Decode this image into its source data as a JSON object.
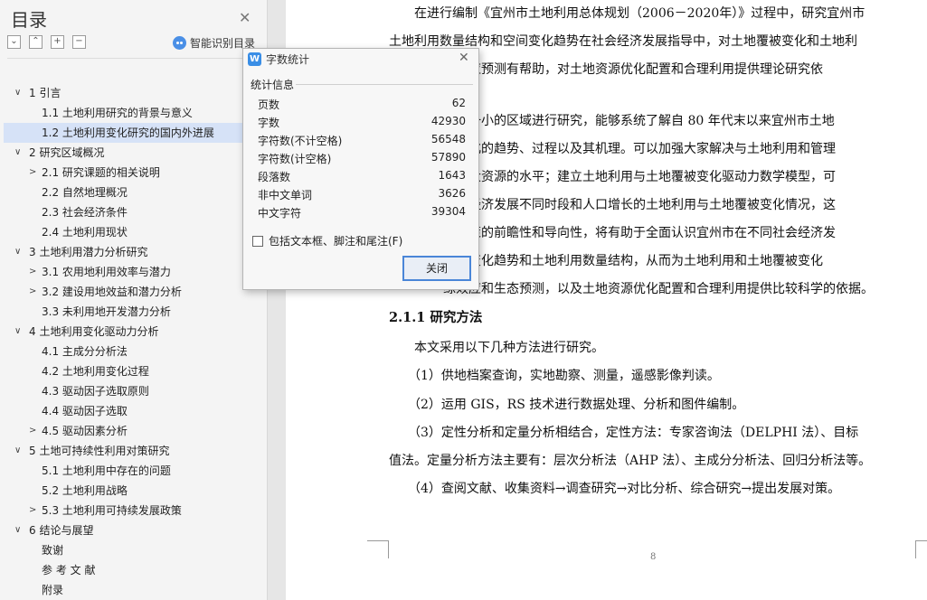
{
  "sidebar": {
    "title": "目录",
    "smart_toc_label": "智能识别目录",
    "tools": [
      "⌄",
      "⌃",
      "+",
      "−"
    ],
    "items": [
      {
        "label": "1  引言",
        "level": 1,
        "caret": "∨",
        "selected": false
      },
      {
        "label": "1.1  土地利用研究的背景与意义",
        "level": 2,
        "caret": "",
        "selected": false
      },
      {
        "label": "1.2  土地利用变化研究的国内外进展",
        "level": 2,
        "caret": "",
        "selected": true
      },
      {
        "label": "2  研究区域概况",
        "level": 1,
        "caret": "∨",
        "selected": false
      },
      {
        "label": "2.1  研究课题的相关说明",
        "level": 2,
        "caret": ">",
        "selected": false
      },
      {
        "label": "2.2  自然地理概况",
        "level": 2,
        "caret": "",
        "selected": false
      },
      {
        "label": "2.3  社会经济条件",
        "level": 2,
        "caret": "",
        "selected": false
      },
      {
        "label": "2.4  土地利用现状",
        "level": 2,
        "caret": "",
        "selected": false
      },
      {
        "label": "3  土地利用潜力分析研究",
        "level": 1,
        "caret": "∨",
        "selected": false
      },
      {
        "label": "3.1  农用地利用效率与潜力",
        "level": 2,
        "caret": ">",
        "selected": false
      },
      {
        "label": "3.2  建设用地效益和潜力分析",
        "level": 2,
        "caret": ">",
        "selected": false
      },
      {
        "label": "3.3  未利用地开发潜力分析",
        "level": 2,
        "caret": "",
        "selected": false
      },
      {
        "label": "4  土地利用变化驱动力分析",
        "level": 1,
        "caret": "∨",
        "selected": false
      },
      {
        "label": "4.1  主成分分析法",
        "level": 2,
        "caret": "",
        "selected": false
      },
      {
        "label": "4.2  土地利用变化过程",
        "level": 2,
        "caret": "",
        "selected": false
      },
      {
        "label": "4.3  驱动因子选取原则",
        "level": 2,
        "caret": "",
        "selected": false
      },
      {
        "label": "4.4  驱动因子选取",
        "level": 2,
        "caret": "",
        "selected": false
      },
      {
        "label": "4.5  驱动因素分析",
        "level": 2,
        "caret": ">",
        "selected": false
      },
      {
        "label": "5  土地可持续性利用对策研究",
        "level": 1,
        "caret": "∨",
        "selected": false
      },
      {
        "label": "5.1  土地利用中存在的问题",
        "level": 2,
        "caret": "",
        "selected": false
      },
      {
        "label": "5.2  土地利用战略",
        "level": 2,
        "caret": "",
        "selected": false
      },
      {
        "label": "5.3  土地利用可持续发展政策",
        "level": 2,
        "caret": ">",
        "selected": false
      },
      {
        "label": "6  结论与展望",
        "level": 1,
        "caret": "∨",
        "selected": false
      },
      {
        "label": "致谢",
        "level": 2,
        "caret": "",
        "selected": false
      },
      {
        "label": "参 考 文 献",
        "level": 2,
        "caret": "",
        "selected": false
      },
      {
        "label": "附录",
        "level": 2,
        "caret": "",
        "selected": false
      }
    ]
  },
  "document": {
    "lines": [
      "　　在进行编制《宜州市土地利用总体规划（2006－2020年）》过程中，研究宜州市",
      "土地利用数量结构和空间变化趋势在社会经济发展指导中，对土地覆被变化和土地利",
      "源效应预测有帮助，对土地资源优化配置和合理利用提供理论研究依",
      "",
      "市这一小的区域进行研究，能够系统了解自 80 年代末以来宜州市土地",
      "被变化的趋势、过程以及其机理。可以加强大家解决与土地利用和管理",
      "与重大资源的水平；建立土地利用与土地覆被变化驱动力数学模型，可",
      "社会经济发展不同时段和人口增长的土地利用与土地覆被变化情况，这",
      "学决策的前瞻性和导向性，将有助于全面认识宜州市在不同社会经济发",
      "空间变化趋势和土地利用数量结构，从而为土地利用和土地覆被变化",
      "综效应和生态预测，以及土地资源优化配置和合理利用提供比较科学的依据。",
      "2.1.1  研究方法",
      "　　本文采用以下几种方法进行研究。",
      "　　（1）供地档案查询，实地勘察、测量，遥感影像判读。",
      "　　（2）运用 GIS，RS 技术进行数据处理、分析和图件编制。",
      "　　（3）定性分析和定量分析相结合，定性方法：专家咨询法（DELPHI 法）、目标",
      "值法。定量分析方法主要有：层次分析法（AHP 法）、主成分分析法、回归分析法等。",
      "　　（4）查阅文献、收集资料→调查研究→对比分析、综合研究→提出发展对策。"
    ],
    "page_number": "8"
  },
  "dialog": {
    "title": "字数统计",
    "section": "统计信息",
    "stats": [
      {
        "label": "页数",
        "value": "62"
      },
      {
        "label": "字数",
        "value": "42930"
      },
      {
        "label": "字符数(不计空格)",
        "value": "56548"
      },
      {
        "label": "字符数(计空格)",
        "value": "57890"
      },
      {
        "label": "段落数",
        "value": "1643"
      },
      {
        "label": "非中文单词",
        "value": "3626"
      },
      {
        "label": "中文字符",
        "value": "39304"
      }
    ],
    "checkbox_label": "包括文本框、脚注和尾注(F)",
    "close_button": "关闭",
    "app_icon_glyph": "W"
  },
  "colors": {
    "selected_bg": "#d6e2f7",
    "accent": "#3a8ee6"
  }
}
